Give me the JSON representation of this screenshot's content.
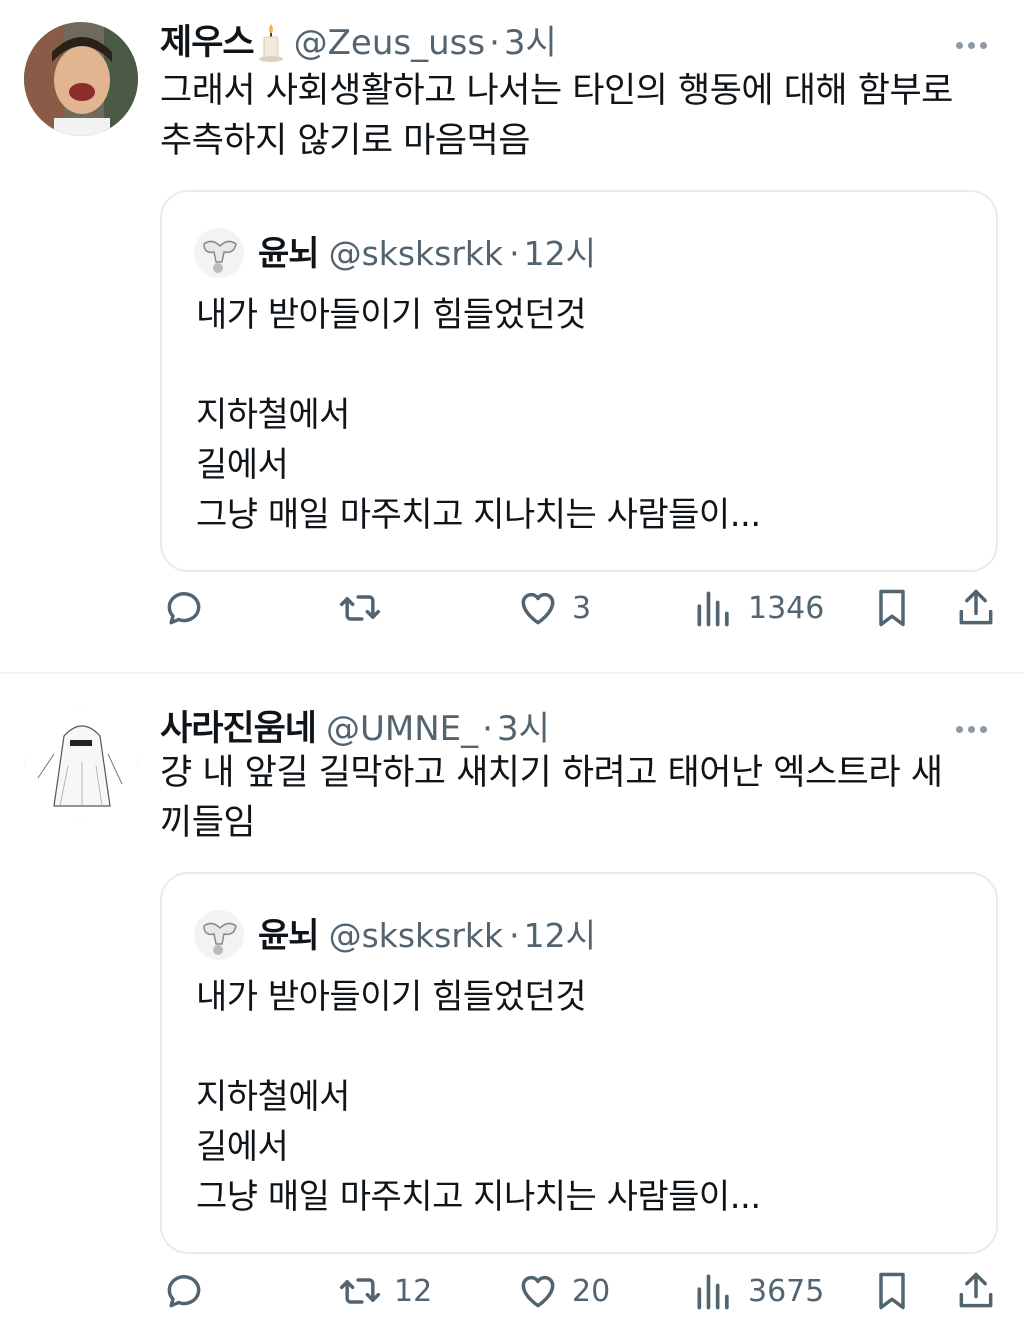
{
  "tweets": [
    {
      "name": "제우스",
      "name_emoji": "🕯",
      "handle": "@Zeus_uss",
      "time": "3시",
      "text": "그래서 사회생활하고 나서는 타인의 행동에 대해 함부로\n추측하지 않기로 마음먹음",
      "quote": {
        "name": "윤뇌",
        "handle": "@sksksrkk",
        "time": "12시",
        "text": "내가 받아들이기 힘들었던것\n\n지하철에서\n길에서\n그냥 매일 마주치고 지나치는 사람들이..."
      },
      "actions": {
        "replies": "",
        "retweets": "",
        "likes": "3",
        "views": "1346"
      }
    },
    {
      "name": "사라진움네",
      "handle": "@UMNE_",
      "time": "3시",
      "text": "걍 내 앞길 길막하고 새치기 하려고 태어난 엑스트라 새\n끼들임",
      "quote": {
        "name": "윤뇌",
        "handle": "@sksksrkk",
        "time": "12시",
        "text": "내가 받아들이기 힘들었던것\n\n지하철에서\n길에서\n그냥 매일 마주치고 지나치는 사람들이..."
      },
      "actions": {
        "replies": "",
        "retweets": "12",
        "likes": "20",
        "views": "3675"
      }
    }
  ],
  "icons": {
    "reply": "reply-icon",
    "retweet": "retweet-icon",
    "like": "heart-icon",
    "views": "views-icon",
    "bookmark": "bookmark-icon",
    "share": "share-icon",
    "more": "more-icon"
  },
  "colors": {
    "text": "#0f1419",
    "secondary": "#536471",
    "border": "#e6ecf0"
  }
}
